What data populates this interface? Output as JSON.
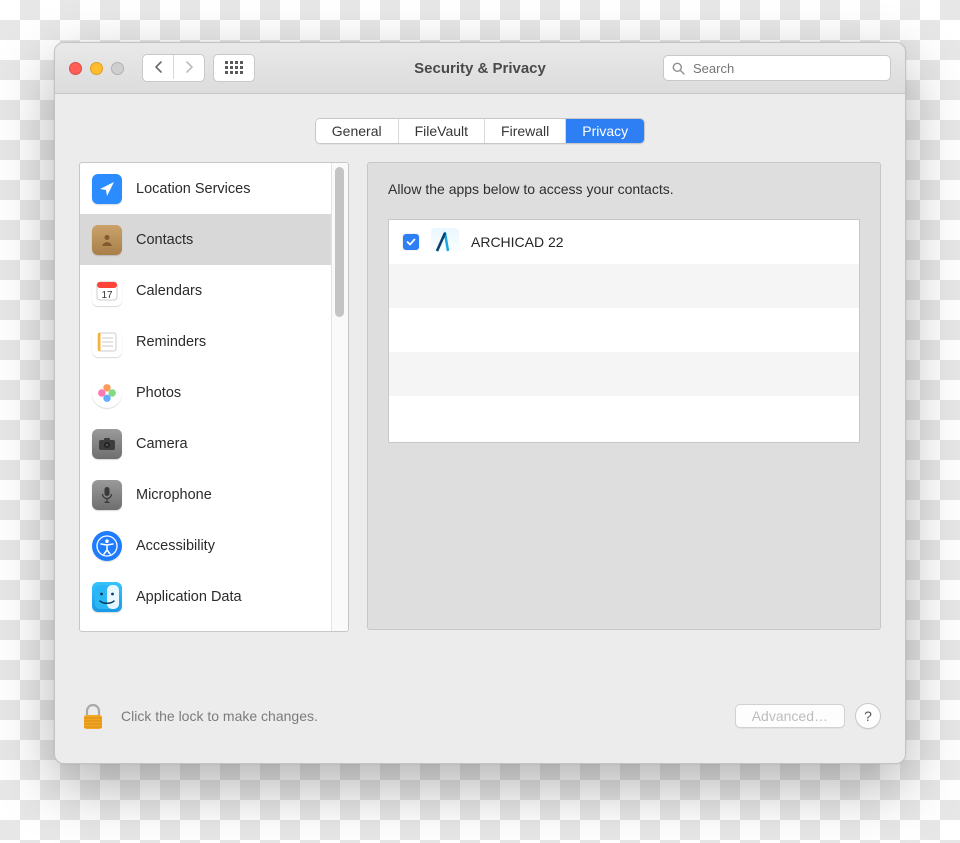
{
  "toolbar": {
    "title": "Security & Privacy",
    "search_placeholder": "Search"
  },
  "tabs": [
    {
      "label": "General",
      "selected": false
    },
    {
      "label": "FileVault",
      "selected": false
    },
    {
      "label": "Firewall",
      "selected": false
    },
    {
      "label": "Privacy",
      "selected": true
    }
  ],
  "sidebar": {
    "items": [
      {
        "label": "Location Services",
        "icon": "location-icon"
      },
      {
        "label": "Contacts",
        "icon": "contacts-icon",
        "selected": true
      },
      {
        "label": "Calendars",
        "icon": "calendar-icon"
      },
      {
        "label": "Reminders",
        "icon": "reminders-icon"
      },
      {
        "label": "Photos",
        "icon": "photos-icon"
      },
      {
        "label": "Camera",
        "icon": "camera-icon"
      },
      {
        "label": "Microphone",
        "icon": "microphone-icon"
      },
      {
        "label": "Accessibility",
        "icon": "accessibility-icon"
      },
      {
        "label": "Application Data",
        "icon": "finder-icon"
      }
    ]
  },
  "detail": {
    "title": "Allow the apps below to access your contacts.",
    "apps": [
      {
        "label": "ARCHICAD 22",
        "checked": true
      }
    ]
  },
  "footer": {
    "lock_note": "Click the lock to make changes.",
    "advanced_label": "Advanced…",
    "help_label": "?"
  }
}
